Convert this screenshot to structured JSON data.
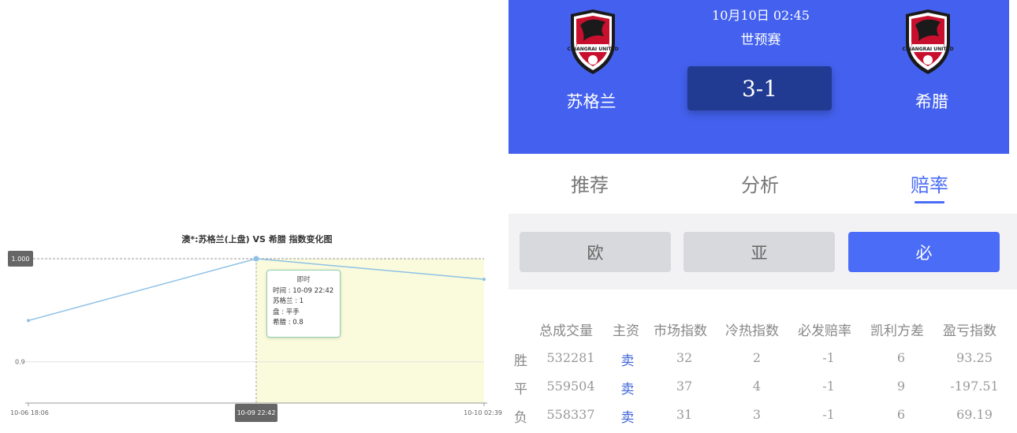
{
  "chart": {
    "title": "澳*:苏格兰(上盘) VS 希腊 指数变化图",
    "y_badge_label": "1.000",
    "y_tick_label": "0.9",
    "x_tick_labels": [
      "10-06 18:06",
      "10-09 22:42",
      "10-10 02:39"
    ],
    "x_badge_label": "10-09 22:42",
    "colors": {
      "line": "#8ec1e6",
      "highlight": "#fafbdc",
      "badge": "#666666"
    },
    "tooltip": {
      "header": "即时",
      "time": "时间 : 10-09 22:42",
      "team1": "苏格兰 : 1",
      "handicap": "盘 : 平手",
      "team2": "希腊 : 0.8"
    }
  },
  "chart_data": {
    "type": "line",
    "title": "澳*:苏格兰(上盘) VS 希腊 指数变化图",
    "x": [
      "10-06 18:06",
      "10-09 22:42",
      "10-10 02:39"
    ],
    "series": [
      {
        "values": [
          0.94,
          1.0,
          0.98
        ]
      }
    ],
    "ylim": [
      0.86,
      1.0
    ],
    "y_ticks": [
      0.9,
      1.0
    ],
    "grid": true,
    "highlighted_point": "10-09 22:42"
  },
  "match": {
    "datetime": "10月10日 02:45",
    "league": "世预赛",
    "score": "3-1",
    "home_team": "苏格兰",
    "away_team": "希腊",
    "logo_text": "CHIANGRAI UNITED",
    "header_color": "#4361ee",
    "score_box_color": "#213a92"
  },
  "tabs": [
    {
      "label": "推荐"
    },
    {
      "label": "分析"
    },
    {
      "label": "赔率"
    }
  ],
  "sub_tabs": [
    {
      "label": "欧"
    },
    {
      "label": "亚"
    },
    {
      "label": "必"
    }
  ],
  "odds_table": {
    "headers": [
      "总成交量",
      "主资",
      "市场指数",
      "冷热指数",
      "必发赔率",
      "凯利方差",
      "盈亏指数"
    ],
    "rows": [
      {
        "label": "胜",
        "cells": [
          "532281",
          "卖",
          "32",
          "2",
          "-1",
          "6",
          "93.25"
        ]
      },
      {
        "label": "平",
        "cells": [
          "559504",
          "卖",
          "37",
          "4",
          "-1",
          "9",
          "-197.51"
        ]
      },
      {
        "label": "负",
        "cells": [
          "558337",
          "卖",
          "31",
          "3",
          "-1",
          "6",
          "69.19"
        ]
      }
    ]
  }
}
